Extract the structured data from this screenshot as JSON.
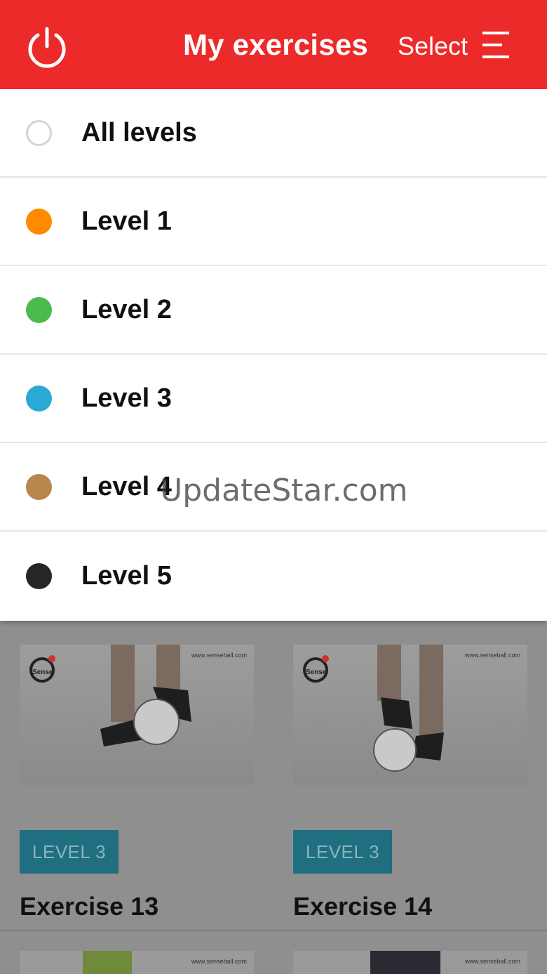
{
  "header": {
    "title": "My exercises",
    "select_label": "Select",
    "background_color": "#ec2a2a"
  },
  "levels": [
    {
      "label": "All levels",
      "color": "#ffffff",
      "selected": false
    },
    {
      "label": "Level 1",
      "color": "#ff8a00"
    },
    {
      "label": "Level 2",
      "color": "#4cbb4f"
    },
    {
      "label": "Level 3",
      "color": "#29a9d3"
    },
    {
      "label": "Level 4",
      "color": "#b8864a"
    },
    {
      "label": "Level 5",
      "color": "#262626"
    }
  ],
  "exercises": [
    {
      "badge": "LEVEL 3",
      "title": "Exercise 13",
      "site": "www.senseball.com"
    },
    {
      "badge": "LEVEL 3",
      "title": "Exercise 14",
      "site": "www.senseball.com"
    }
  ],
  "more_thumbs": [
    {
      "site": "www.senseball.com"
    },
    {
      "site": "www.senseball.com"
    }
  ],
  "watermark": "UpdateStar.com",
  "icons": {
    "power": "power-icon",
    "menu": "hamburger-menu-icon"
  }
}
